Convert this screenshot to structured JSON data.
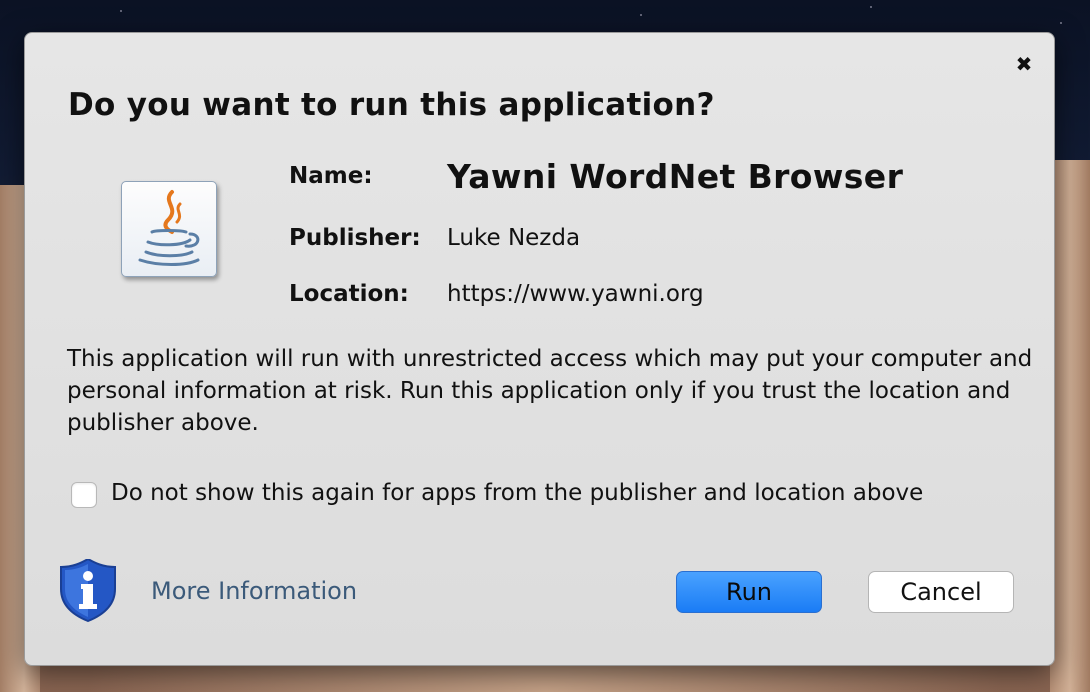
{
  "dialog": {
    "title": "Do you want to run this application?",
    "close_icon": "close-icon",
    "fields": {
      "name_label": "Name:",
      "name_value": "Yawni WordNet Browser",
      "publisher_label": "Publisher:",
      "publisher_value": "Luke Nezda",
      "location_label": "Location:",
      "location_value": "https://www.yawni.org"
    },
    "warning_text": "This application will run with unrestricted access which may put your computer and personal information at risk. Run this application only if you trust the location and publisher above.",
    "checkbox": {
      "label": "Do not show this again for apps from the publisher and location above",
      "checked": false
    },
    "more_information_label": "More Information",
    "buttons": {
      "run_label": "Run",
      "cancel_label": "Cancel"
    },
    "icons": {
      "app": "java-coffee-cup-icon",
      "info": "info-shield-icon"
    },
    "colors": {
      "run_button": "#1a7cf5",
      "link": "#3b5a7a",
      "shield": "#2457c5"
    }
  }
}
